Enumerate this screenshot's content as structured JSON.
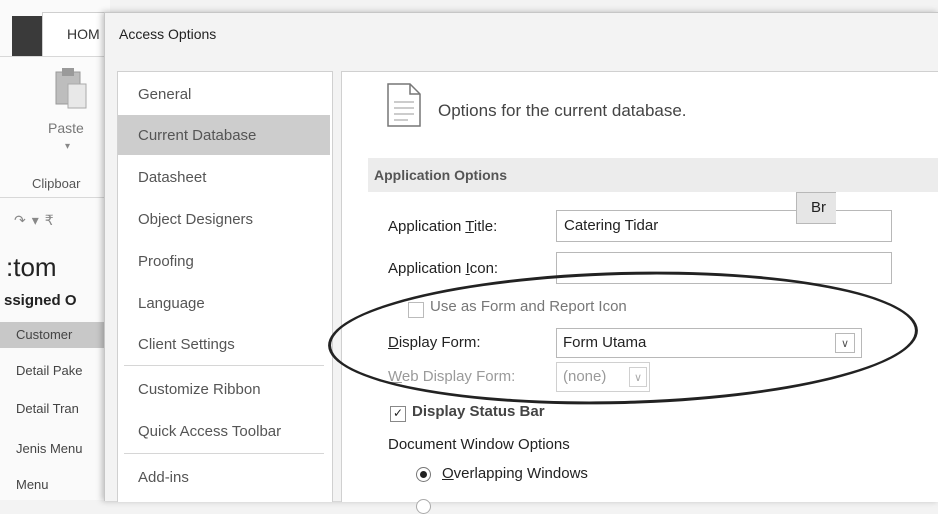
{
  "background_app": {
    "home_tab": "HOM",
    "paste_label": "Paste",
    "clipboard_label": "Clipboar",
    "nav_heading": ":tom",
    "nav_subheading": "ssigned O",
    "nav_items": [
      "Customer",
      "Detail Pake",
      "Detail Tran",
      "Jenis Menu",
      "Menu"
    ]
  },
  "dialog": {
    "title": "Access Options",
    "sidebar": [
      "General",
      "Current Database",
      "Datasheet",
      "Object Designers",
      "Proofing",
      "Language",
      "Client Settings",
      "Customize Ribbon",
      "Quick Access Toolbar",
      "Add-ins"
    ],
    "selected": "Current Database",
    "header": "Options for the current database.",
    "section": "Application Options",
    "app_title": {
      "label_pre": "Application ",
      "label_key": "T",
      "label_post": "itle:",
      "value": "Catering Tidar"
    },
    "app_icon": {
      "label_pre": "Application ",
      "label_key": "I",
      "label_post": "con:",
      "value": "",
      "browse": "Br"
    },
    "use_as_icon": {
      "label": "Use as Form and Report Icon",
      "checked": false
    },
    "display_form": {
      "label_key": "D",
      "label_post": "isplay Form:",
      "value": "Form Utama"
    },
    "web_display_form": {
      "label_key": "W",
      "label_post": "eb Display Form:",
      "value": "(none)"
    },
    "display_status_bar": {
      "label": "Display Status Bar",
      "checked": true
    },
    "doc_window_options": "Document Window Options",
    "overlapping": {
      "label_key": "O",
      "label_post": "verlapping Windows",
      "selected": true
    }
  }
}
